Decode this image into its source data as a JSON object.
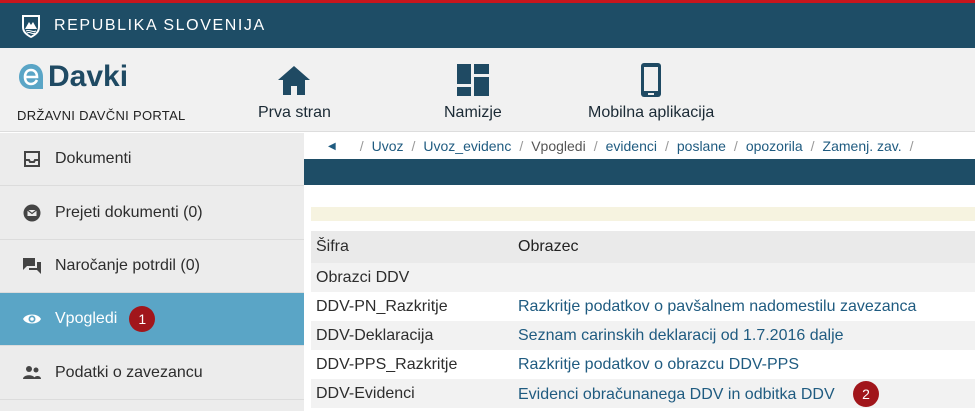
{
  "gov_bar": {
    "title": "REPUBLIKA SLOVENIJA"
  },
  "header": {
    "logo_text": "Davki",
    "subtitle": "DRŽAVNI DAVČNI PORTAL",
    "nav": [
      {
        "label": "Prva stran",
        "icon": "home-icon"
      },
      {
        "label": "Namizje",
        "icon": "dashboard-icon"
      },
      {
        "label": "Mobilna aplikacija",
        "icon": "mobile-icon"
      }
    ]
  },
  "sidebar": {
    "items": [
      {
        "label": "Dokumenti",
        "icon": "inbox-icon"
      },
      {
        "label": "Prejeti dokumenti (0)",
        "icon": "mail-icon"
      },
      {
        "label": "Naročanje potrdil (0)",
        "icon": "chat-icon"
      },
      {
        "label": "Vpogledi",
        "icon": "eye-icon",
        "active": true,
        "badge": "1"
      },
      {
        "label": "Podatki o zavezancu",
        "icon": "people-icon"
      }
    ]
  },
  "breadcrumb": [
    "Uvoz",
    "Uvoz_evidenc",
    "Vpogledi",
    "evidenci",
    "poslane",
    "opozorila",
    "Zamenj. zav."
  ],
  "table": {
    "headers": [
      "Šifra",
      "Obrazec"
    ],
    "group_label": "Obrazci DDV",
    "rows": [
      {
        "code": "DDV-PN_Razkritje",
        "form": "Razkritje podatkov o pavšalnem nadomestilu zavezanca"
      },
      {
        "code": "DDV-Deklaracija",
        "form": "Seznam carinskih deklaracij od 1.7.2016 dalje"
      },
      {
        "code": "DDV-PPS_Razkritje",
        "form": "Razkritje podatkov o obrazcu DDV-PPS"
      },
      {
        "code": "DDV-Evidenci",
        "form": "Evidenci obračunanega DDV in odbitka DDV",
        "badge": "2"
      }
    ]
  },
  "colors": {
    "gov_bar": "#1e4d66",
    "active": "#5aa5c6",
    "badge": "#a1161b",
    "link": "#1f5b80"
  }
}
